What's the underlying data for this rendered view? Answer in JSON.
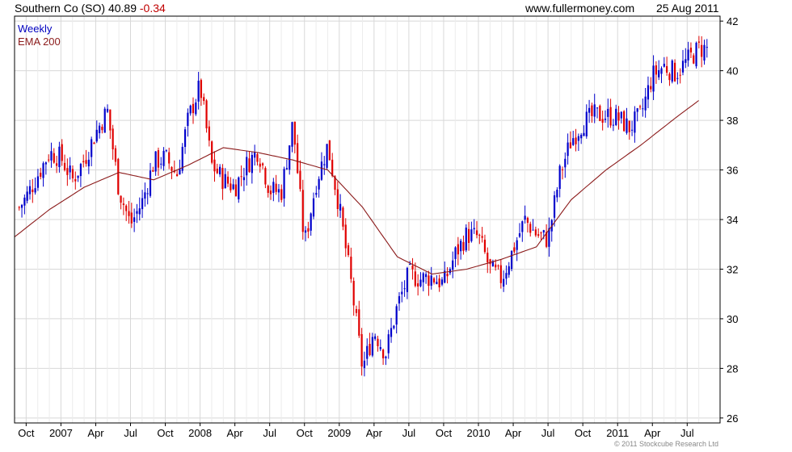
{
  "header": {
    "title": "Southern Co (SO)",
    "price": "40.89",
    "change": "-0.34",
    "site": "www.fullermoney.com",
    "date": "25 Aug 2011"
  },
  "legend": {
    "weekly": "Weekly",
    "ema": "EMA 200"
  },
  "copyright": "© 2011 Stockcube Research Ltd",
  "colors": {
    "up": "#0000cc",
    "down": "#e00000",
    "ema": "#8b1a1a",
    "grid": "#d8d8d8",
    "frame": "#000000"
  },
  "chart_data": {
    "type": "candlestick",
    "x_tick_labels": [
      "Oct",
      "2007",
      "Apr",
      "Jul",
      "Oct",
      "2008",
      "Apr",
      "Jul",
      "Oct",
      "2009",
      "Apr",
      "Jul",
      "Oct",
      "2010",
      "Apr",
      "Jul",
      "Oct",
      "2011",
      "Apr",
      "Jul"
    ],
    "y_ticks": [
      26,
      28,
      30,
      32,
      34,
      36,
      38,
      40,
      42
    ],
    "ylim": [
      25.8,
      42.2
    ],
    "y_axis_side": "right",
    "grid": true,
    "legend_position": "top-left",
    "series": [
      {
        "name": "Weekly",
        "close_points": [
          [
            "Sep 2006",
            34.2
          ],
          [
            "Oct 2006",
            34.9
          ],
          [
            "Nov 2006",
            35.8
          ],
          [
            "Dec 2006",
            36.7
          ],
          [
            "Jan 2007",
            36.5
          ],
          [
            "Feb 2007",
            35.6
          ],
          [
            "Mar 2007",
            36.4
          ],
          [
            "Apr 2007",
            37.5
          ],
          [
            "May 2007",
            38.4
          ],
          [
            "Jun 2007",
            35.2
          ],
          [
            "Jul 2007",
            33.8
          ],
          [
            "Aug 2007",
            34.7
          ],
          [
            "Sep 2007",
            36.3
          ],
          [
            "Oct 2007",
            36.5
          ],
          [
            "Nov 2007",
            35.8
          ],
          [
            "Dec 2007",
            38.1
          ],
          [
            "Jan 2008",
            39.4
          ],
          [
            "Feb 2008",
            36.2
          ],
          [
            "Mar 2008",
            35.6
          ],
          [
            "Apr 2008",
            35.3
          ],
          [
            "May 2008",
            36.2
          ],
          [
            "Jun 2008",
            36.8
          ],
          [
            "Jul 2008",
            35.2
          ],
          [
            "Aug 2008",
            35.1
          ],
          [
            "Sep 2008",
            37.9
          ],
          [
            "Oct 2008",
            33.0
          ],
          [
            "Nov 2008",
            35.5
          ],
          [
            "Dec 2008",
            37.0
          ],
          [
            "Jan 2009",
            34.5
          ],
          [
            "Feb 2009",
            31.5
          ],
          [
            "Mar 2009",
            28.0
          ],
          [
            "Apr 2009",
            29.5
          ],
          [
            "May 2009",
            28.6
          ],
          [
            "Jun 2009",
            30.5
          ],
          [
            "Jul 2009",
            31.8
          ],
          [
            "Aug 2009",
            31.6
          ],
          [
            "Sep 2009",
            31.7
          ],
          [
            "Oct 2009",
            31.4
          ],
          [
            "Nov 2009",
            32.6
          ],
          [
            "Dec 2009",
            33.4
          ],
          [
            "Jan 2010",
            33.3
          ],
          [
            "Feb 2010",
            32.0
          ],
          [
            "Mar 2010",
            31.6
          ],
          [
            "Apr 2010",
            32.8
          ],
          [
            "May 2010",
            34.0
          ],
          [
            "Jun 2010",
            33.4
          ],
          [
            "Jul 2010",
            33.2
          ],
          [
            "Aug 2010",
            35.8
          ],
          [
            "Sep 2010",
            37.2
          ],
          [
            "Oct 2010",
            37.9
          ],
          [
            "Nov 2010",
            38.2
          ],
          [
            "Dec 2010",
            38.2
          ],
          [
            "Jan 2011",
            38.1
          ],
          [
            "Feb 2011",
            37.7
          ],
          [
            "Mar 2011",
            38.2
          ],
          [
            "Apr 2011",
            39.8
          ],
          [
            "May 2011",
            40.2
          ],
          [
            "Jun 2011",
            39.9
          ],
          [
            "Jul 2011",
            40.4
          ],
          [
            "Aug 2011",
            40.89
          ]
        ]
      },
      {
        "name": "EMA 200",
        "points": [
          [
            "Sep 2006",
            33.3
          ],
          [
            "Dec 2006",
            34.4
          ],
          [
            "Mar 2007",
            35.3
          ],
          [
            "Jun 2007",
            35.9
          ],
          [
            "Sep 2007",
            35.6
          ],
          [
            "Dec 2007",
            36.2
          ],
          [
            "Mar 2008",
            36.9
          ],
          [
            "Jun 2008",
            36.7
          ],
          [
            "Sep 2008",
            36.4
          ],
          [
            "Dec 2008",
            36.0
          ],
          [
            "Mar 2009",
            34.5
          ],
          [
            "Jun 2009",
            32.5
          ],
          [
            "Sep 2009",
            31.8
          ],
          [
            "Dec 2009",
            32.0
          ],
          [
            "Mar 2010",
            32.4
          ],
          [
            "Jun 2010",
            32.9
          ],
          [
            "Sep 2010",
            34.8
          ],
          [
            "Dec 2010",
            36.0
          ],
          [
            "Mar 2011",
            37.0
          ],
          [
            "Jun 2011",
            38.1
          ],
          [
            "Aug 2011",
            38.8
          ]
        ]
      }
    ]
  }
}
